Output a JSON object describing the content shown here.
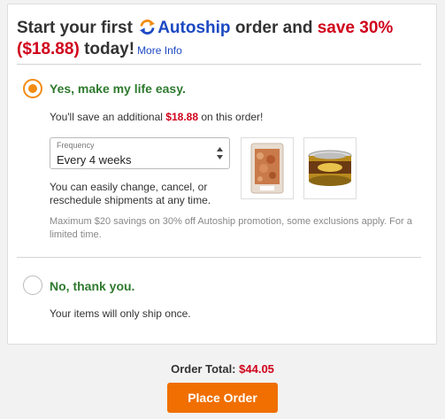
{
  "headline": {
    "part1": "Start your first",
    "brand": "Autoship",
    "part2": "order and",
    "save": "save 30% ($18.88)",
    "part3": "today!",
    "more_info": "More Info"
  },
  "option_yes": {
    "label": "Yes, make my life easy.",
    "selected": true,
    "savings_prefix": "You'll save an additional",
    "savings_amount": "$18.88",
    "savings_suffix": "on this order!",
    "frequency_label": "Frequency",
    "frequency_value": "Every 4 weeks",
    "change_line1": "You can easily change, cancel, or",
    "change_line2": "reschedule shipments at any time.",
    "disclaimer_line1": "Maximum $20 savings on 30% off Autoship promotion, some exclusions apply. For a",
    "disclaimer_line2": "limited time."
  },
  "products": [
    {
      "icon": "treat-bag-icon"
    },
    {
      "icon": "canned-food-icon"
    }
  ],
  "option_no": {
    "label": "No, thank you.",
    "selected": false,
    "note": "Your items will only ship once."
  },
  "footer": {
    "order_total_label": "Order Total:",
    "order_total_amount": "$44.05",
    "place_order": "Place Order"
  },
  "colors": {
    "brand_blue": "#1c49c2",
    "sale_red": "#d0021b",
    "option_green": "#2f7a2f",
    "accent_orange": "#f06f00"
  }
}
